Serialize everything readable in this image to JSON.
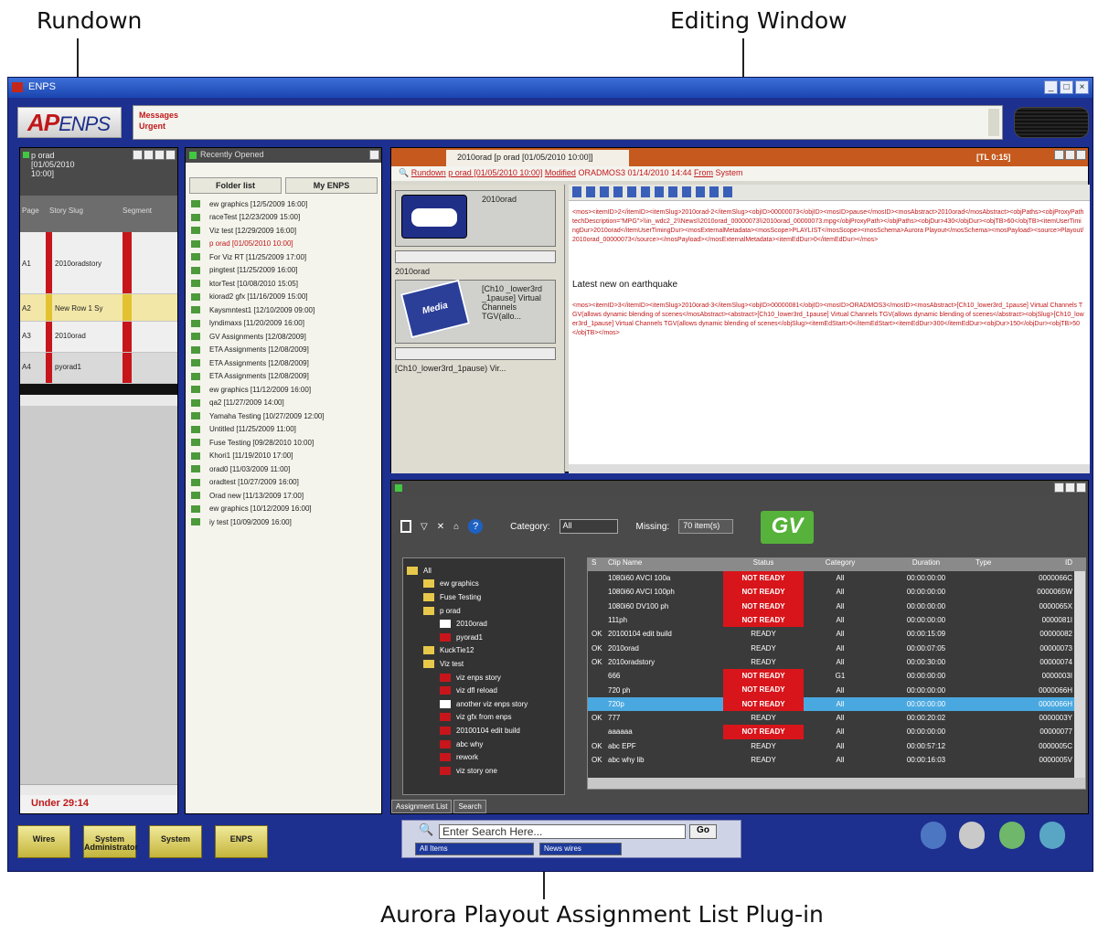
{
  "callouts": {
    "rundown": "Rundown",
    "editing": "Editing Window",
    "aurora": "Aurora Playout Assignment List Plug-in"
  },
  "window": {
    "title": "ENPS"
  },
  "logo": {
    "ap": "AP",
    "enps": "ENPS"
  },
  "messages": {
    "line1": "Messages",
    "line2": "Urgent"
  },
  "rundown": {
    "header": [
      "p orad",
      "[01/05/2010",
      "10:00]"
    ],
    "columns": [
      "Page",
      "Story Slug",
      "Segment"
    ],
    "rows": [
      {
        "page": "A1",
        "slug": "2010oradstory"
      },
      {
        "page": "A2",
        "slug": "New Row 1 Sy"
      },
      {
        "page": "A3",
        "slug": "2010orad"
      },
      {
        "page": "A4",
        "slug": "pyorad1"
      }
    ],
    "status": "Under 29:14"
  },
  "recent": {
    "title": "Recently Opened",
    "tabs": [
      "Folder list",
      "My ENPS"
    ],
    "items": [
      "ew graphics [12/5/2009 16:00]",
      "raceTest [12/23/2009 15:00]",
      "Viz test [12/29/2009 16:00]",
      "p orad [01/05/2010 10:00]",
      "For Viz RT [11/25/2009 17:00]",
      "pingtest [11/25/2009 16:00]",
      "ktorTest [10/08/2010 15:05]",
      "kiorad2 gfx [11/16/2009 15:00]",
      "Kaysmntest1 [12/10/2009 09:00]",
      "lyndimaxs [11/20/2009 16:00]",
      "GV Assignments [12/08/2009]",
      "ETA Assignments [12/08/2009]",
      "ETA Assignments [12/08/2009]",
      "ETA Assignments [12/08/2009]",
      "ew graphics [11/12/2009 16:00]",
      "qa2 [11/27/2009 14:00]",
      "Yamaha Testing [10/27/2009 12:00]",
      "Untitled [11/25/2009 11:00]",
      "Fuse Testing [09/28/2010 10:00]",
      "Khori1 [11/19/2010 17:00]",
      "orad0 [11/03/2009 11:00]",
      "oradtest [10/27/2009 16:00]",
      "Orad new [11/13/2009 17:00]",
      "ew graphics [10/12/2009 16:00]",
      "iy test [10/09/2009 16:00]"
    ]
  },
  "editing": {
    "tab": "2010orad [p orad [01/05/2010 10:00]]",
    "badge": "[TL 0:15]",
    "link": {
      "rundown": "Rundown",
      "rundown_detail": "p orad [01/05/2010 10:00]",
      "modified": "Modified",
      "who": "ORADMOS3  01/14/2010 14:44",
      "from": "From",
      "system": "System"
    },
    "clip1": {
      "name": "2010orad",
      "caption": "2010orad"
    },
    "clip2": {
      "name": "[Ch10 _lower3rd _1pause] Virtual Channels TGV(allo...",
      "caption": "[Ch10_lower3rd_1pause) Vir...",
      "card": "Media"
    },
    "mos1": "<mos><itemID>2</itemID><itemSlug>2010orad-2</itemSlug><objID>00000073</objID><mosID>pause</mosID><mosAbstract>2010orad</mosAbstract><objPaths><objProxyPath techDescription=\"MPG\">\\\\in_wdc2_2\\\\News\\\\2010orad_00000073\\\\2010orad_00000073.mpg</objProxyPath></objPaths><objDur>430</objDur><objTB>60</objTB><itemUserTimingDur>2010orad</itemUserTimingDur><mosExternalMetadata><mosScope>PLAYLIST</mosScope><mosSchema>Aurora Playout</mosSchema><mosPayload><source>Playout/2010orad_00000073</source></mosPayload></mosExternalMetadata><itemEdDur>0</itemEdDur></mos>",
    "latest": "Latest new on earthquake",
    "mos2": "<mos><itemID>3</itemID><itemSlug>2010orad-3</itemSlug><objID>00000081</objID><mosID>ORADMOS3</mosID><mosAbstract>[Ch10_lower3rd_1pause] Virtual Channels TGV(allows dynamic blending of scenes</mosAbstract><abstract>[Ch10_lower3rd_1pause] Virtual Channels TGV(allows dynamic blending of scenes</abstract><objSlug>[Ch10_lower3rd_1pause] Virtual Channels TGV(allows dynamic blending of scenes</objSlug><itemEdStart>0</itemEdStart><itemEdDur>300</itemEdDur><objDur>150</objDur><objTB>50</objTB></mos>"
  },
  "aurora": {
    "category_label": "Category:",
    "category_value": "All",
    "missing_label": "Missing:",
    "missing_value": "70 item(s)",
    "gv": "GV",
    "tree": [
      {
        "label": "All",
        "type": "folder",
        "indent": 0
      },
      {
        "label": "ew graphics",
        "type": "folder",
        "indent": 1
      },
      {
        "label": "Fuse Testing",
        "type": "folder",
        "indent": 1
      },
      {
        "label": "p orad",
        "type": "folder",
        "indent": 1
      },
      {
        "label": "2010orad",
        "type": "white",
        "indent": 2
      },
      {
        "label": "pyorad1",
        "type": "red",
        "indent": 2
      },
      {
        "label": "KuckTie12",
        "type": "folder",
        "indent": 1
      },
      {
        "label": "Viz test",
        "type": "folder",
        "indent": 1
      },
      {
        "label": "viz enps story",
        "type": "red",
        "indent": 2
      },
      {
        "label": "viz dfl reload",
        "type": "red",
        "indent": 2
      },
      {
        "label": "another viz enps story",
        "type": "white",
        "indent": 2
      },
      {
        "label": "viz gfx from enps",
        "type": "red",
        "indent": 2
      },
      {
        "label": "20100104 edit build",
        "type": "red",
        "indent": 2
      },
      {
        "label": "abc why",
        "type": "red",
        "indent": 2
      },
      {
        "label": "rework",
        "type": "red",
        "indent": 2
      },
      {
        "label": "viz story one",
        "type": "red",
        "indent": 2
      }
    ],
    "columns": [
      "S",
      "Clip Name",
      "Status",
      "Category",
      "Duration",
      "Type",
      "ID"
    ],
    "rows": [
      {
        "s": "",
        "name": "1080i60 AVCI 100a",
        "status": "NOT READY",
        "cat": "All",
        "dur": "00:00:00:00",
        "id": "0000066C"
      },
      {
        "s": "",
        "name": "1080i60 AVCI 100ph",
        "status": "NOT READY",
        "cat": "All",
        "dur": "00:00:00:00",
        "id": "0000065W"
      },
      {
        "s": "",
        "name": "1080i60 DV100 ph",
        "status": "NOT READY",
        "cat": "All",
        "dur": "00:00:00:00",
        "id": "0000065X"
      },
      {
        "s": "",
        "name": "111ph",
        "status": "NOT READY",
        "cat": "All",
        "dur": "00:00:00:00",
        "id": "0000081I"
      },
      {
        "s": "OK",
        "name": "20100104 edit build",
        "status": "READY",
        "cat": "All",
        "dur": "00:00:15:09",
        "id": "00000082"
      },
      {
        "s": "OK",
        "name": "2010orad",
        "status": "READY",
        "cat": "All",
        "dur": "00:00:07:05",
        "id": "00000073"
      },
      {
        "s": "OK",
        "name": "2010oradstory",
        "status": "READY",
        "cat": "All",
        "dur": "00:00:30:00",
        "id": "00000074"
      },
      {
        "s": "",
        "name": "666",
        "status": "NOT READY",
        "cat": "G1",
        "dur": "00:00:00:00",
        "id": "0000003I"
      },
      {
        "s": "",
        "name": "720 ph",
        "status": "NOT READY",
        "cat": "All",
        "dur": "00:00:00:00",
        "id": "0000066H"
      },
      {
        "s": "",
        "name": "720p",
        "status": "NOT READY",
        "cat": "All",
        "dur": "00:00:00:00",
        "id": "0000066H"
      },
      {
        "s": "OK",
        "name": "777",
        "status": "READY",
        "cat": "All",
        "dur": "00:00:20:02",
        "id": "0000003Y"
      },
      {
        "s": "",
        "name": "aaaaaa",
        "status": "NOT READY",
        "cat": "All",
        "dur": "00:00:00:00",
        "id": "00000077"
      },
      {
        "s": "OK",
        "name": "abc EPF",
        "status": "READY",
        "cat": "All",
        "dur": "00:00:57:12",
        "id": "0000005C"
      },
      {
        "s": "OK",
        "name": "abc why lib",
        "status": "READY",
        "cat": "All",
        "dur": "00:00:16:03",
        "id": "0000005V"
      }
    ],
    "tabs": [
      "Assignment List",
      "Search"
    ]
  },
  "bottom": {
    "folders": [
      "Wires",
      "System Administrator",
      "System",
      "ENPS"
    ],
    "search_placeholder": "Enter Search Here...",
    "go": "Go",
    "opt1": "All Items",
    "opt2": "News wires"
  }
}
